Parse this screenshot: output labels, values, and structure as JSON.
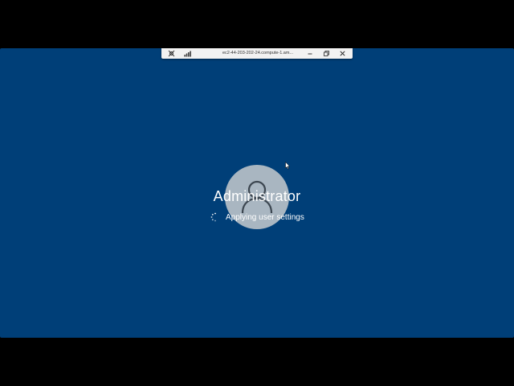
{
  "remote_session_bar": {
    "connection_title": "ec2-44-203-202-24.compute-1.am...",
    "pin_icon": "pin-icon",
    "signal_icon": "connection-signal-icon",
    "minimize_icon": "minimize-icon",
    "restore_icon": "restore-icon",
    "close_icon": "close-icon"
  },
  "login_screen": {
    "background_color": "#003f78",
    "avatar_icon": "user-silhouette-icon",
    "username": "Administrator",
    "status_text": "Applying user settings",
    "spinner_icon": "loading-spinner-icon"
  }
}
